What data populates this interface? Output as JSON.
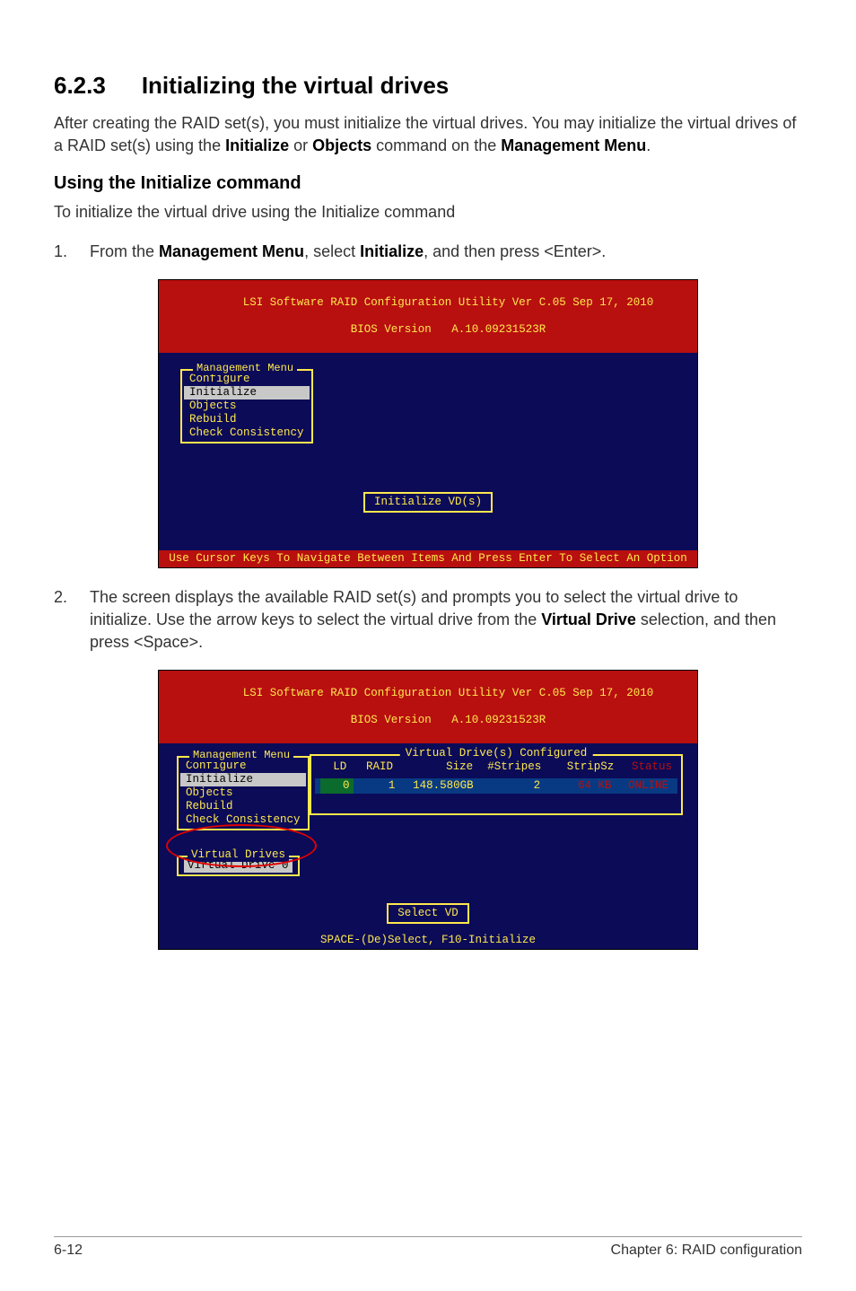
{
  "heading": {
    "number": "6.2.3",
    "title": "Initializing the virtual drives"
  },
  "intro": {
    "prefix": "After creating the RAID set(s), you must initialize the virtual drives. You may initialize the virtual drives of a RAID set(s) using the ",
    "bold1": "Initialize",
    "mid": " or ",
    "bold2": "Objects",
    "after": " command on the ",
    "bold3": "Management Menu",
    "suffix": "."
  },
  "subheading": "Using the Initialize command",
  "lead": "To initialize the virtual drive using the Initialize command",
  "step1": {
    "marker": "1.",
    "prefix": "From the ",
    "b1": "Management Menu",
    "mid": ", select ",
    "b2": "Initialize",
    "suffix": ", and then press <Enter>."
  },
  "terminal1": {
    "title_line1": "LSI Software RAID Configuration Utility Ver C.05 Sep 17, 2010",
    "title_line2": "BIOS Version   A.10.09231523R",
    "menu_title": "Management Menu",
    "items": [
      "Configure",
      "Initialize",
      "Objects",
      "Rebuild",
      "Check Consistency"
    ],
    "highlight_index": 1,
    "center_label": "Initialize VD(s)",
    "footer": "Use Cursor Keys To Navigate Between Items And Press Enter To Select An Option"
  },
  "step2": {
    "marker": "2.",
    "prefix": "The screen displays the available RAID set(s) and prompts you to select the virtual drive to initialize. Use the arrow keys to select the virtual drive from the ",
    "b1": "Virtual Drive",
    "suffix": " selection, and then press <Space>."
  },
  "terminal2": {
    "title_line1": "LSI Software RAID Configuration Utility Ver C.05 Sep 17, 2010",
    "title_line2": "BIOS Version   A.10.09231523R",
    "menu_title": "Management Menu",
    "items": [
      "Configure",
      "Initialize",
      "Objects",
      "Rebuild",
      "Check Consistency"
    ],
    "highlight_index": 1,
    "vd_title": "Virtual Drive(s) Configured",
    "columns": {
      "ld": "LD",
      "raid": "RAID",
      "size": "Size",
      "stripes": "#Stripes",
      "ssz": "StripSz",
      "status": "Status"
    },
    "row": {
      "ld": "0",
      "raid": "1",
      "size": "148.580GB",
      "stripes": "2",
      "ssz": "64 KB",
      "status": "ONLINE"
    },
    "sub_title": "Virtual Drives",
    "sub_item": "Virtual Drive 0",
    "center_label": "Select VD",
    "footer": "SPACE-(De)Select,  F10-Initialize"
  },
  "chart_data": {
    "type": "table",
    "title": "Virtual Drive(s) Configured",
    "columns": [
      "LD",
      "RAID",
      "Size",
      "#Stripes",
      "StripSz",
      "Status"
    ],
    "rows": [
      [
        "0",
        "1",
        "148.580GB",
        "2",
        "64 KB",
        "ONLINE"
      ]
    ]
  },
  "page_footer": {
    "left": "6-12",
    "right": "Chapter 6: RAID configuration"
  }
}
